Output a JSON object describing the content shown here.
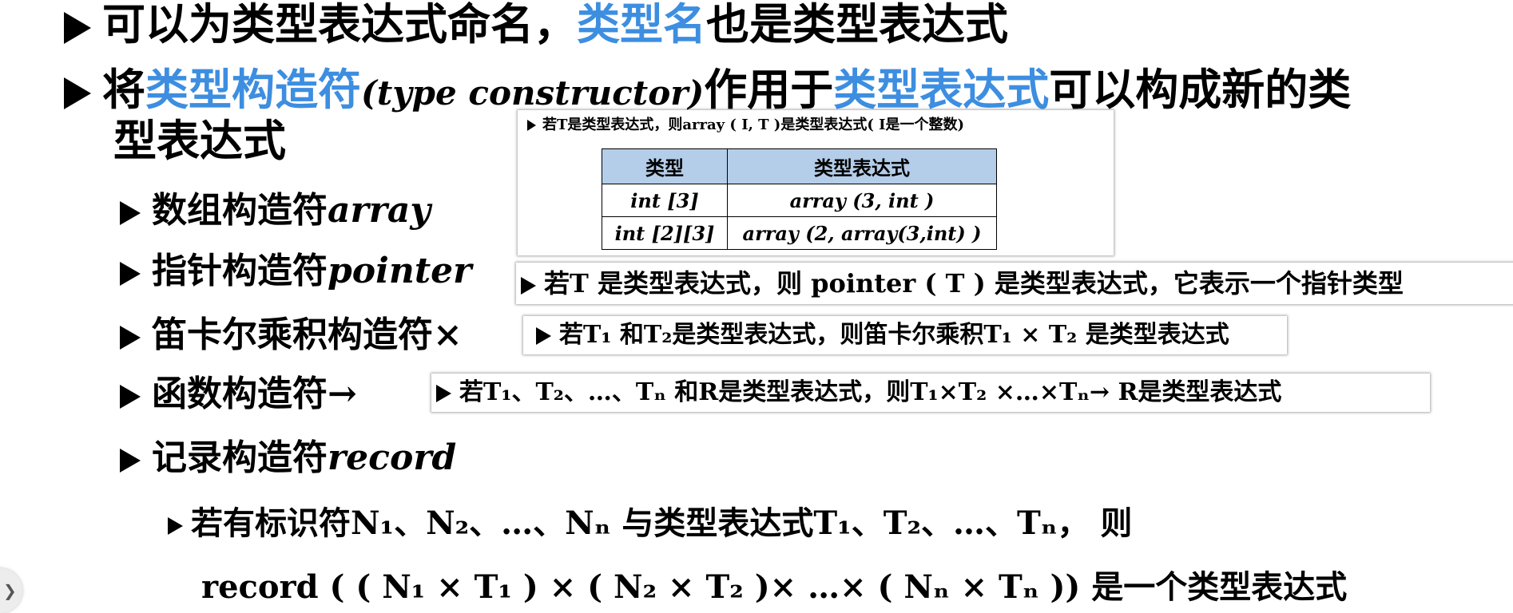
{
  "bullets": {
    "b1": {
      "pre": "可以为类型表达式命名，",
      "hl": "类型名",
      "post": "也是类型表达式"
    },
    "b2": {
      "pre": "将",
      "hl1": "类型构造符",
      "paren": "(type constructor)",
      "mid": "作用于",
      "hl2": "类型表达式",
      "post": "可以构成新的类",
      "cont": "型表达式"
    }
  },
  "constructors": {
    "array": {
      "cn": "数组构造符",
      "en": "array"
    },
    "pointer": {
      "cn": "指针构造符",
      "en": "pointer"
    },
    "cartesian": {
      "cn": "笛卡尔乘积构造符×"
    },
    "function": {
      "cn": "函数构造符→"
    },
    "record": {
      "cn": "记录构造符",
      "en": "record"
    }
  },
  "notes": {
    "array": {
      "header": "若T是类型表达式，则array ( I, T )是类型表达式( I是一个整数)",
      "table": {
        "headers": [
          "类型",
          "类型表达式"
        ],
        "rows": [
          [
            "int [3]",
            "array (3, int )"
          ],
          [
            "int [2][3]",
            "array (2, array(3,int) )"
          ]
        ]
      }
    },
    "pointer": "若T 是类型表达式，则 pointer ( T ) 是类型表达式，它表示一个指针类型",
    "cartesian": "若T₁ 和T₂是类型表达式，则笛卡尔乘积T₁ × T₂ 是类型表达式",
    "function": "若T₁、T₂、…、Tₙ 和R是类型表达式，则T₁×T₂ ×…×Tₙ→ R是类型表达式",
    "record1": "若有标识符N₁、N₂、…、Nₙ 与类型表达式T₁、T₂、…、Tₙ， 则",
    "record2": "record ( ( N₁ × T₁ ) × ( N₂ × T₂ )× …× ( Nₙ × Tₙ )) 是一个类型表达式"
  },
  "colors": {
    "highlight": "#3d8ee0",
    "table_header": "#b4cde9"
  },
  "icons": {
    "bullet": "triangle-arrow-icon",
    "nav": "chevron-right-icon"
  }
}
